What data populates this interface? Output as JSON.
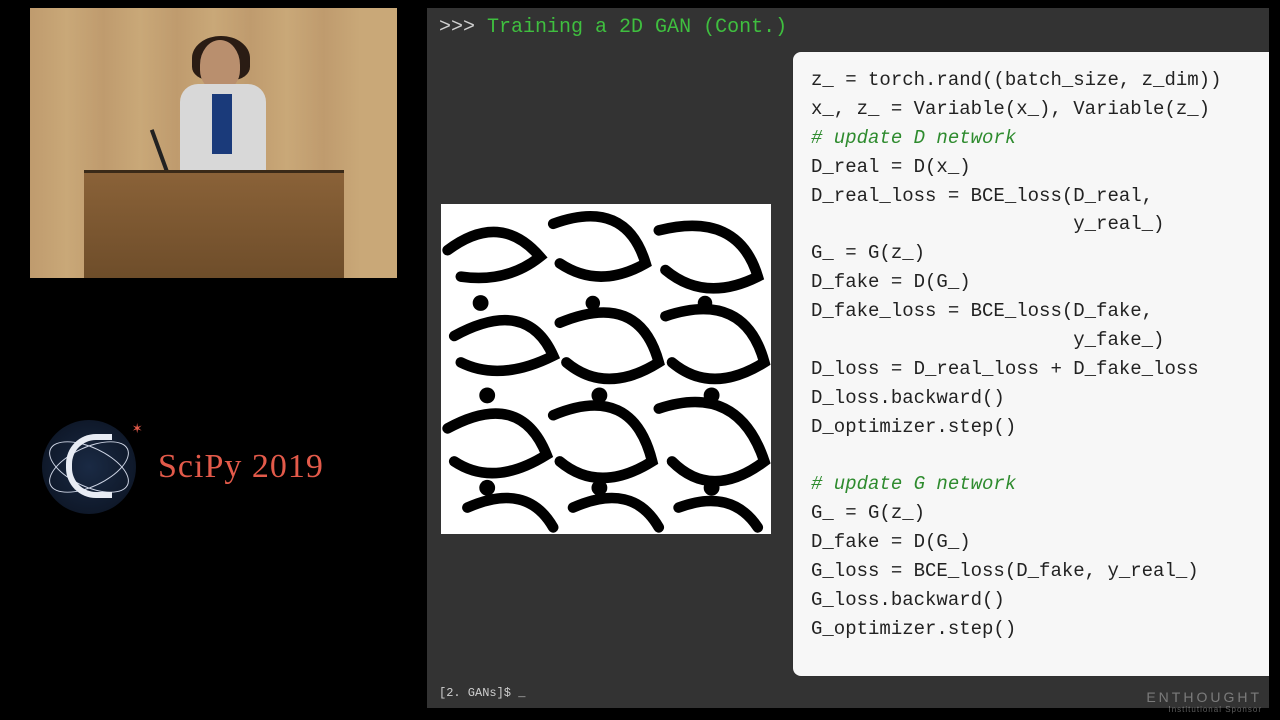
{
  "conference": {
    "name": "SciPy 2019"
  },
  "slide": {
    "prompt_prefix": ">>>",
    "title": "Training a 2D GAN (Cont.)",
    "footer_prompt": "[2. GANs]$ _",
    "code": {
      "l1": "z_ = torch.rand((batch_size, z_dim))",
      "l2": "x_, z_ = Variable(x_), Variable(z_)",
      "c1": "# update D network",
      "l3": "D_real = D(x_)",
      "l4": "D_real_loss = BCE_loss(D_real,",
      "l4b": "                       y_real_)",
      "l5": "G_ = G(z_)",
      "l6": "D_fake = D(G_)",
      "l7": "D_fake_loss = BCE_loss(D_fake,",
      "l7b": "                       y_fake_)",
      "l8": "D_loss = D_real_loss + D_fake_loss",
      "l9": "D_loss.backward()",
      "l10": "D_optimizer.step()",
      "blank": "",
      "c2": "# update G network",
      "l11": "G_ = G(z_)",
      "l12": "D_fake = D(G_)",
      "l13": "G_loss = BCE_loss(D_fake, y_real_)",
      "l14": "G_loss.backward()",
      "l15": "G_optimizer.step()"
    }
  },
  "sponsor": {
    "brand": "ENTHOUGHT",
    "sub": "Institutional Sponsor"
  }
}
